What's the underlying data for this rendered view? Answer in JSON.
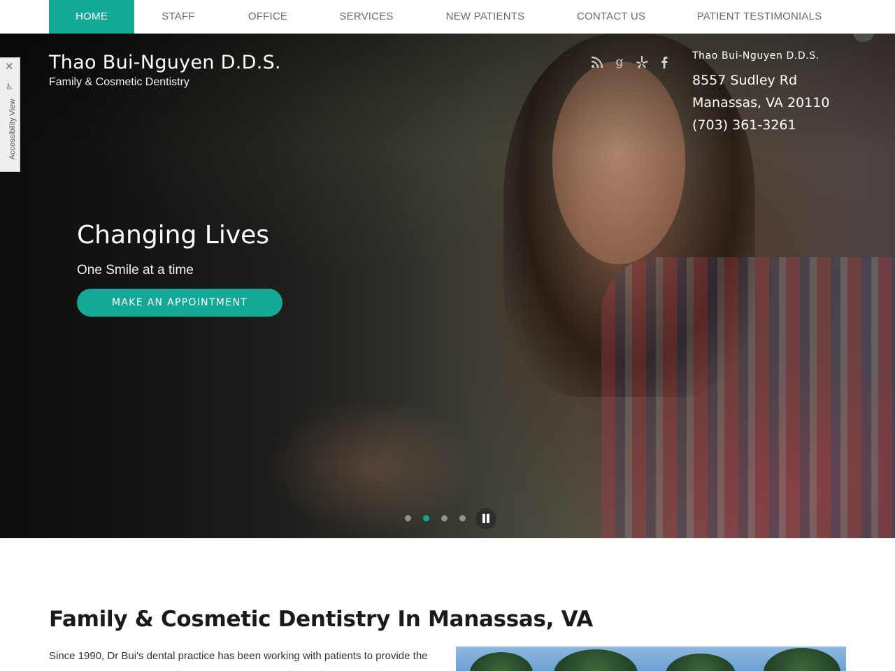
{
  "nav": {
    "items": [
      {
        "label": "HOME",
        "active": true
      },
      {
        "label": "STAFF",
        "active": false
      },
      {
        "label": "OFFICE",
        "active": false
      },
      {
        "label": "SERVICES",
        "active": false
      },
      {
        "label": "NEW PATIENTS",
        "active": false
      },
      {
        "label": "CONTACT US",
        "active": false
      },
      {
        "label": "PATIENT TESTIMONIALS",
        "active": false
      }
    ]
  },
  "brand": {
    "title": "Thao Bui-Nguyen D.D.S.",
    "subtitle": "Family & Cosmetic Dentistry"
  },
  "social": [
    "rss-icon",
    "google-icon",
    "yelp-icon",
    "facebook-icon"
  ],
  "contact": {
    "name": "Thao Bui-Nguyen D.D.S.",
    "street": "8557 Sudley Rd",
    "city": "Manassas, VA 20110",
    "phone": "(703) 361-3261"
  },
  "hero": {
    "heading": "Changing Lives",
    "subheading": "One Smile at a time",
    "cta_label": "MAKE AN APPOINTMENT",
    "slides_total": 4,
    "active_slide": 2
  },
  "accessibility": {
    "label": "Accessibility View",
    "close_glyph": "✕"
  },
  "content": {
    "title": "Family & Cosmetic Dentistry In Manassas, VA",
    "paragraph": "Since 1990, Dr Bui's dental practice has been working with patients to provide the"
  },
  "colors": {
    "accent": "#14a896",
    "nav_text": "#6b6b6b"
  }
}
